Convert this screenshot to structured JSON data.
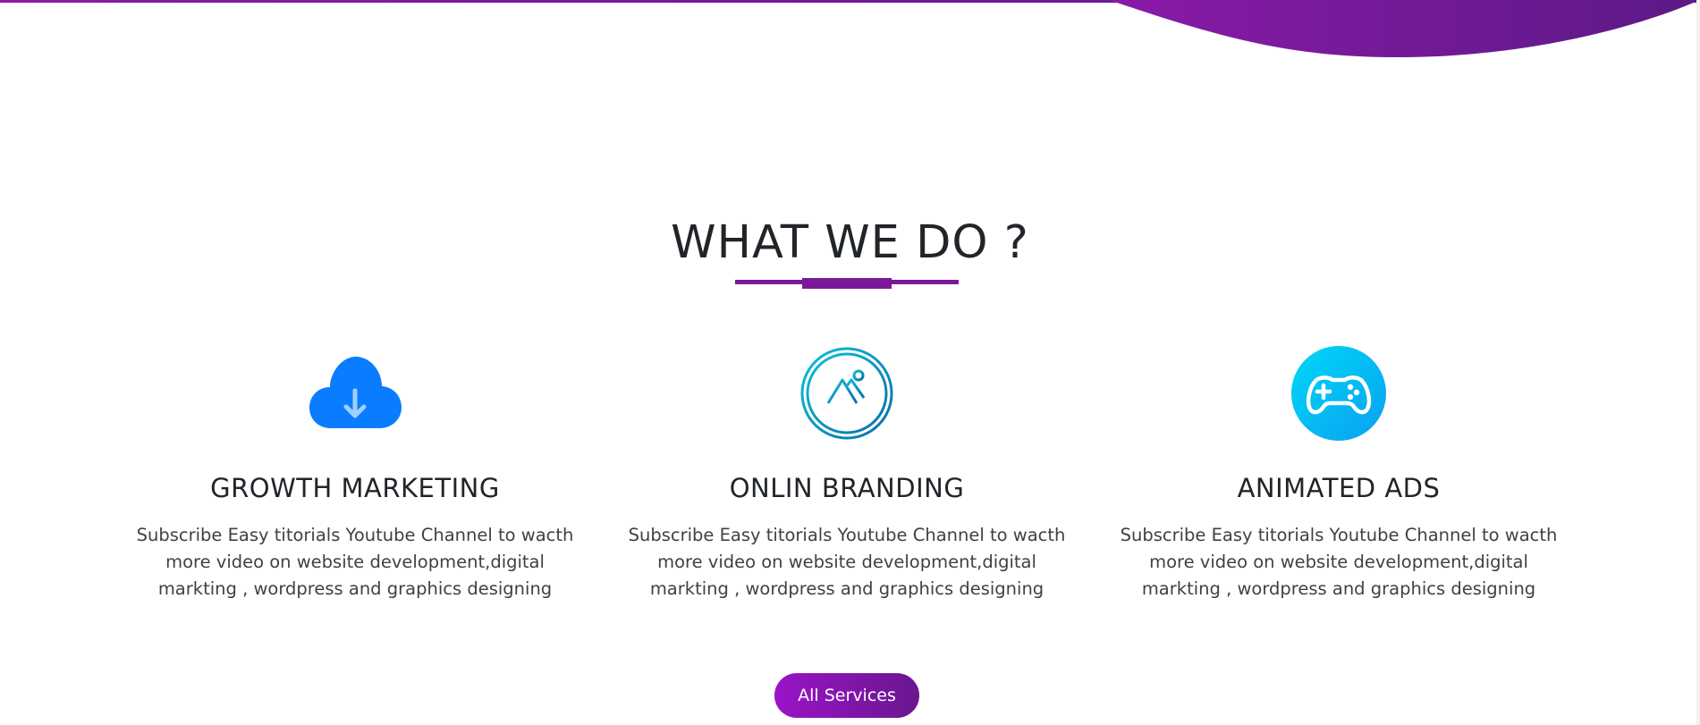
{
  "section": {
    "title": "WHAT WE DO ?"
  },
  "services": [
    {
      "icon": "cloud-download-icon",
      "title": "GROWTH MARKETING",
      "text": "Subscribe Easy titorials Youtube Channel to wacth more video on website development,digital markting , wordpress and graphics designing"
    },
    {
      "icon": "mountain-image-icon",
      "title": "ONLIN BRANDING",
      "text": "Subscribe Easy titorials Youtube Channel to wacth more video on website development,digital markting , wordpress and graphics designing"
    },
    {
      "icon": "gamepad-icon",
      "title": "ANIMATED ADS",
      "text": "Subscribe Easy titorials Youtube Channel to wacth more video on website development,digital markting , wordpress and graphics designing"
    }
  ],
  "cta": {
    "label": "All Services"
  },
  "colors": {
    "accent": "#7a1996",
    "wave_start": "#8a1aa8",
    "wave_end": "#5c1a86",
    "icon_blue": "#0a7cff",
    "icon_teal": "#0aa4c8",
    "icon_cyan": "#00d2f6"
  }
}
